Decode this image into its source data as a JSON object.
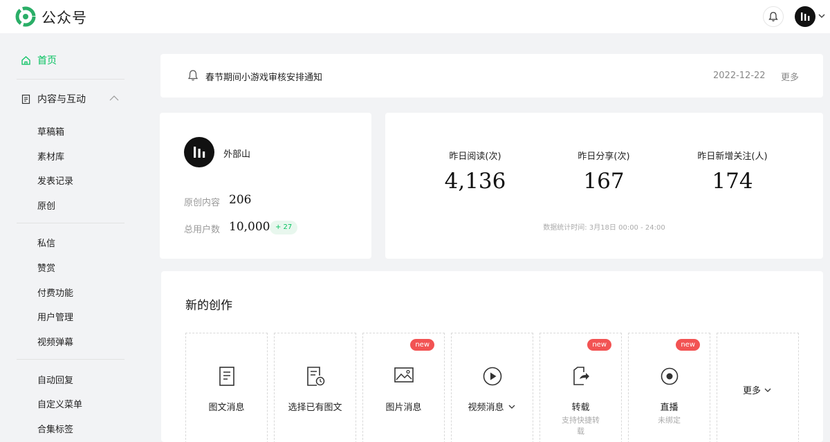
{
  "header": {
    "brand": "公众号"
  },
  "sidebar": {
    "home_label": "首页",
    "group_label": "内容与互动",
    "items_section1": [
      "草稿箱",
      "素材库",
      "发表记录",
      "原创"
    ],
    "items_section2": [
      "私信",
      "赞赏",
      "付费功能",
      "用户管理",
      "视频弹幕"
    ],
    "items_section3": [
      "自动回复",
      "自定义菜单",
      "合集标签"
    ]
  },
  "notice": {
    "text": "春节期间小游戏审核安排通知",
    "date": "2022-12-22",
    "more": "更多"
  },
  "account": {
    "name": "外部山",
    "original_label": "原创内容",
    "original_value": "206",
    "users_label": "总用户数",
    "users_value": "10,000",
    "users_delta": "+ 27"
  },
  "stats": {
    "reads_label": "昨日阅读(次)",
    "reads_value": "4,136",
    "shares_label": "昨日分享(次)",
    "shares_value": "167",
    "follows_label": "昨日新增关注(人)",
    "follows_value": "174",
    "note": "数据统计时间: 3月18日 00:00 - 24:00"
  },
  "create": {
    "title": "新的创作",
    "tiles": [
      {
        "label": "图文消息",
        "icon": "article-icon"
      },
      {
        "label": "选择已有图文",
        "icon": "article-history-icon"
      },
      {
        "label": "图片消息",
        "icon": "image-icon",
        "badge": "new"
      },
      {
        "label": "视频消息",
        "icon": "play-icon"
      },
      {
        "label": "转载",
        "icon": "repost-icon",
        "badge": "new",
        "sub": "支持快捷转载"
      },
      {
        "label": "直播",
        "icon": "live-icon",
        "badge": "new",
        "sub": "未绑定"
      }
    ],
    "more": "更多"
  },
  "colors": {
    "accent": "#07c160",
    "badge_red": "#f25353"
  }
}
